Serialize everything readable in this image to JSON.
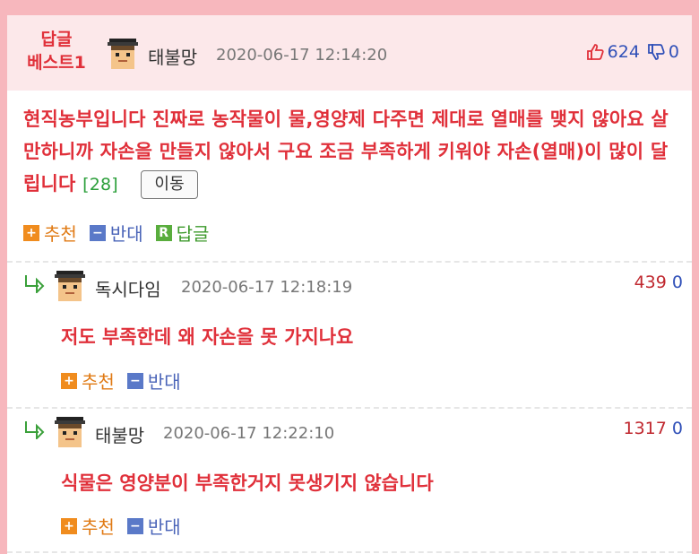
{
  "best_comment": {
    "badge_line1": "답글",
    "badge_line2": "베스트1",
    "username": "태불망",
    "timestamp": "2020-06-17 12:14:20",
    "upvotes": "624",
    "downvotes": "0",
    "text": "현직농부입니다 진짜로 농작물이 물,영양제 다주면 제대로 열매를 맺지 않아요 살만하니까 자손을 만들지 않아서 구요 조금 부족하게 키워야 자손(열매)이 많이 달립니다",
    "reply_count": "[28]",
    "move_button": "이동",
    "actions": {
      "recommend": "추천",
      "oppose": "반대",
      "reply": "답글",
      "recommend_icon": "+",
      "oppose_icon": "−",
      "reply_icon": "R"
    }
  },
  "replies": [
    {
      "username": "독시다임",
      "timestamp": "2020-06-17 12:18:19",
      "upvotes": "439",
      "downvotes": "0",
      "text": "저도 부족한데 왜 자손을 못 가지나요",
      "recommend": "추천",
      "oppose": "반대"
    },
    {
      "username": "태불망",
      "timestamp": "2020-06-17 12:22:10",
      "upvotes": "1317",
      "downvotes": "0",
      "text": "식물은 영양분이 부족한거지 못생기지 않습니다",
      "recommend": "추천",
      "oppose": "반대"
    }
  ],
  "colors": {
    "accent_red": "#e0303a",
    "border_pink": "#f7b7bd",
    "header_bg": "#fce8ea",
    "reply_green": "#2b9f3a"
  },
  "icons": {
    "avatar": "pixel-face-avatar-icon",
    "thumbs_up": "thumbs-up-icon",
    "thumbs_down": "thumbs-down-icon",
    "reply_arrow": "reply-arrow-icon"
  }
}
